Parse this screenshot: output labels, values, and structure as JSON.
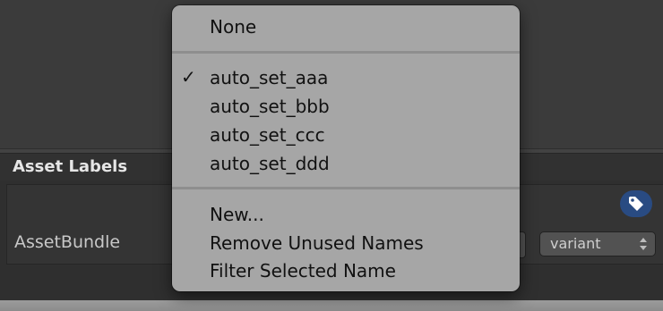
{
  "inspector": {
    "section_title": "Asset Labels",
    "assetbundle_label": "AssetBundle",
    "variant_value": "variant",
    "tag_icon": "tag-icon"
  },
  "menu": {
    "none_label": "None",
    "bundles": [
      {
        "label": "auto_set_aaa",
        "checked": true
      },
      {
        "label": "auto_set_bbb",
        "checked": false
      },
      {
        "label": "auto_set_ccc",
        "checked": false
      },
      {
        "label": "auto_set_ddd",
        "checked": false
      }
    ],
    "checkmark": "✓",
    "actions": [
      "New...",
      "Remove Unused Names",
      "Filter Selected Name"
    ]
  },
  "colors": {
    "menu_background": "#a6a6a6",
    "tag_button": "#294b82",
    "panel_dark": "#2f2f2f"
  }
}
